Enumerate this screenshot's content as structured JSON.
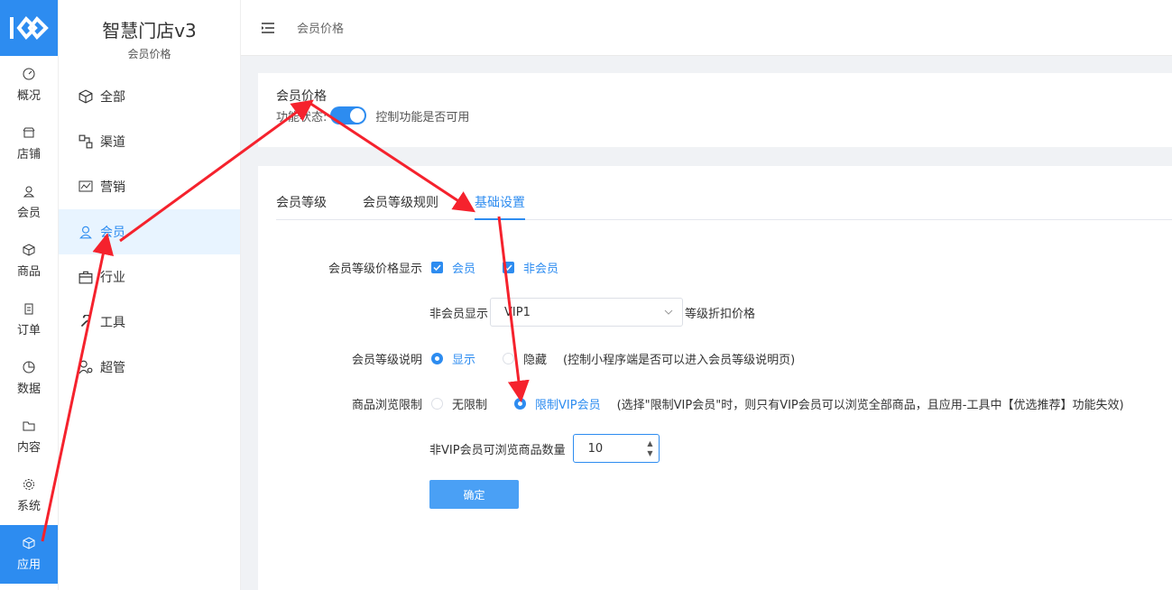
{
  "brand": {
    "name": "智慧门店v3",
    "sub": "会员价格"
  },
  "nav1": [
    {
      "label": "概况",
      "icon": "dashboard-icon"
    },
    {
      "label": "店铺",
      "icon": "shop-icon"
    },
    {
      "label": "会员",
      "icon": "user-icon"
    },
    {
      "label": "商品",
      "icon": "box-icon"
    },
    {
      "label": "订单",
      "icon": "clipboard-icon"
    },
    {
      "label": "数据",
      "icon": "pie-chart-icon"
    },
    {
      "label": "内容",
      "icon": "folder-icon"
    },
    {
      "label": "系统",
      "icon": "gear-icon"
    },
    {
      "label": "应用",
      "icon": "app-box-icon",
      "active": true
    }
  ],
  "nav2": [
    {
      "label": "全部",
      "icon": "cube-icon"
    },
    {
      "label": "渠道",
      "icon": "channel-icon"
    },
    {
      "label": "营销",
      "icon": "chart-icon"
    },
    {
      "label": "会员",
      "icon": "user-icon",
      "active": true
    },
    {
      "label": "行业",
      "icon": "briefcase-icon"
    },
    {
      "label": "工具",
      "icon": "tool-icon"
    },
    {
      "label": "超管",
      "icon": "admin-icon"
    }
  ],
  "header": {
    "breadcrumb": "会员价格"
  },
  "panel1": {
    "title": "会员价格",
    "status_label": "功能状态:",
    "switch_on": true,
    "switch_desc": "控制功能是否可用"
  },
  "tabs": [
    {
      "label": "会员等级"
    },
    {
      "label": "会员等级规则"
    },
    {
      "label": "基础设置",
      "active": true
    }
  ],
  "form": {
    "price_display": {
      "label": "会员等级价格显示",
      "opt1": "会员",
      "opt2": "非会员"
    },
    "nonmember": {
      "prefix": "非会员显示",
      "value": "VIP1",
      "suffix": "等级折扣价格"
    },
    "level_desc": {
      "label": "会员等级说明",
      "opt1": "显示",
      "opt2": "隐藏",
      "hint": "(控制小程序端是否可以进入会员等级说明页)"
    },
    "browse": {
      "label": "商品浏览限制",
      "opt1": "无限制",
      "opt2": "限制VIP会员",
      "hint": "(选择\"限制VIP会员\"时，则只有VIP会员可以浏览全部商品，且应用-工具中【优选推荐】功能失效)"
    },
    "count": {
      "label": "非VIP会员可浏览商品数量",
      "value": "10"
    },
    "submit": "确定"
  },
  "colors": {
    "accent": "#2d8cf0",
    "arrow": "#f5222d"
  }
}
